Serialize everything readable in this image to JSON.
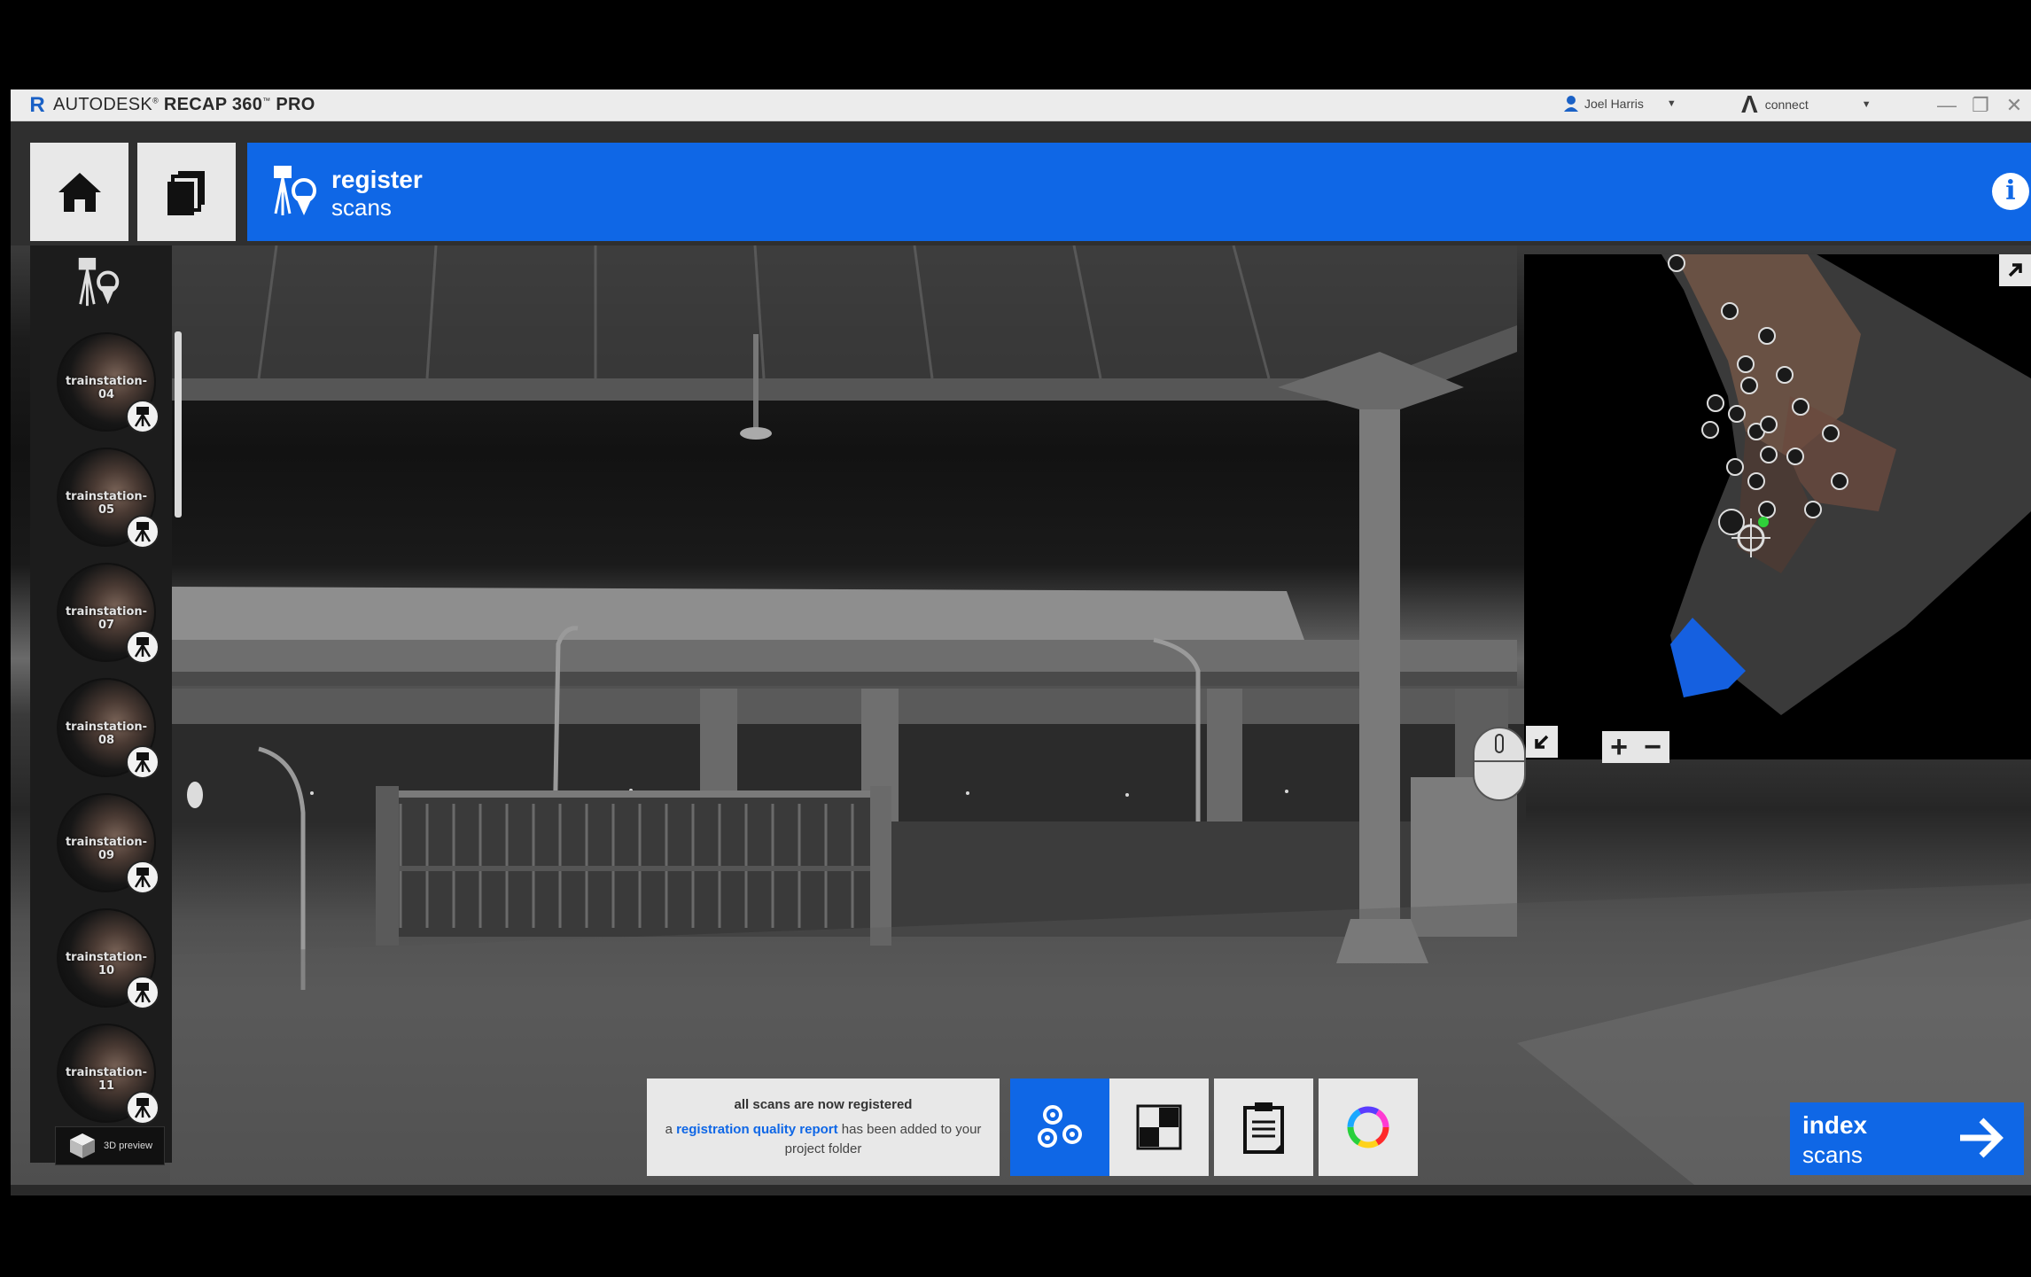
{
  "window": {
    "logo_letter": "R",
    "title_brand": "AUTODESK",
    "title_product": "RECAP 360",
    "title_edition": "PRO",
    "user_name": "Joel Harris",
    "connect_label": "connect",
    "minimize": "—",
    "restore": "❐",
    "close": "✕"
  },
  "header": {
    "step_title": "register",
    "step_subtitle": "scans",
    "info_glyph": "i"
  },
  "sidebar": {
    "scans": [
      {
        "label": "trainstation-04"
      },
      {
        "label": "trainstation-05"
      },
      {
        "label": "trainstation-07"
      },
      {
        "label": "trainstation-08"
      },
      {
        "label": "trainstation-09"
      },
      {
        "label": "trainstation-10"
      },
      {
        "label": "trainstation-11"
      }
    ],
    "preview_label": "3D preview"
  },
  "minimap": {
    "zoom_in": "+",
    "zoom_out": "−"
  },
  "status": {
    "title": "all scans are now registered",
    "line_prefix": "a",
    "link_text": "registration quality report",
    "line_suffix": "has been added to your project folder"
  },
  "next_step": {
    "line1": "index",
    "line2": "scans"
  },
  "colors": {
    "accent": "#0f67e6",
    "button_bg": "#e8e8e8",
    "titlebar_bg": "#ececec"
  },
  "icons": [
    "home-icon",
    "projects-icon",
    "register-scans-icon",
    "info-icon",
    "scanner-icon",
    "cube-icon",
    "expand-icon",
    "collapse-icon",
    "mouse-icon",
    "register-icon",
    "checkerboard-icon",
    "clipboard-icon",
    "color-wheel-icon",
    "arrow-right-icon"
  ]
}
